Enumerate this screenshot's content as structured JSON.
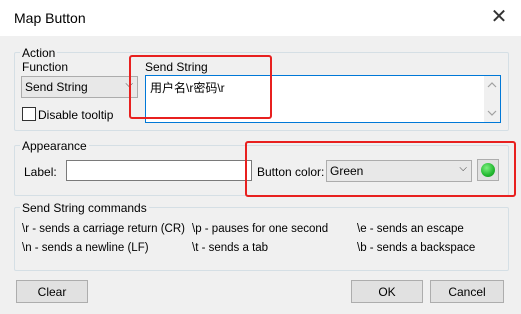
{
  "window": {
    "title": "Map Button",
    "close_glyph": "✕"
  },
  "action": {
    "group_label": "Action",
    "function_label": "Function",
    "function_value": "Send String",
    "disable_tooltip_label": "Disable tooltip",
    "disable_tooltip_checked": false,
    "send_string_label": "Send String",
    "send_string_value": "用户名\\r密码\\r"
  },
  "appearance": {
    "group_label": "Appearance",
    "label_label": "Label:",
    "label_value": "",
    "button_color_label": "Button color:",
    "button_color_value": "Green",
    "swatch_color": "#22b830"
  },
  "commands": {
    "group_label": "Send String commands",
    "items": [
      "\\r - sends a carriage return (CR)",
      "\\p - pauses for one second",
      "\\e - sends an escape",
      "\\n - sends a newline (LF)",
      "\\t - sends a tab",
      "\\b - sends a backspace"
    ]
  },
  "buttons": {
    "clear": "Clear",
    "ok": "OK",
    "cancel": "Cancel"
  },
  "colors": {
    "highlight": "#e8201f",
    "focus_border": "#0078d7"
  }
}
